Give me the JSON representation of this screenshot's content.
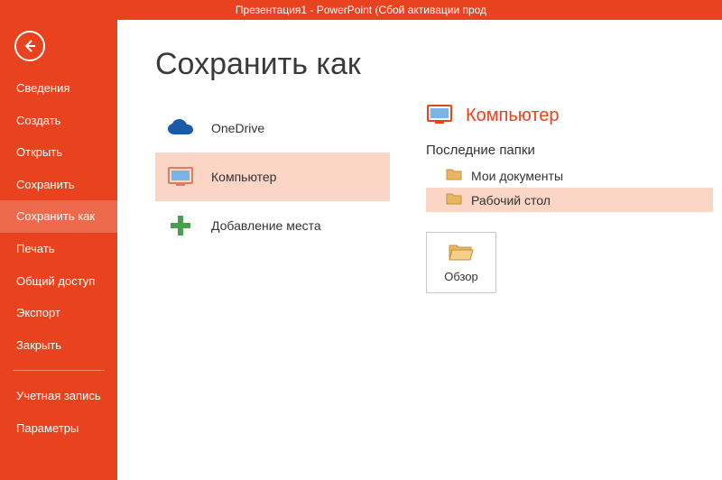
{
  "titlebar": "Презентация1 -  PowerPoint (Сбой активации прод",
  "sidebar": {
    "items": [
      "Сведения",
      "Создать",
      "Открыть",
      "Сохранить",
      "Сохранить как",
      "Печать",
      "Общий доступ",
      "Экспорт",
      "Закрыть"
    ],
    "bottom": [
      "Учетная запись",
      "Параметры"
    ],
    "selectedIndex": 4
  },
  "page": {
    "title": "Сохранить как",
    "locations": [
      {
        "icon": "cloud",
        "label": "OneDrive"
      },
      {
        "icon": "computer",
        "label": "Компьютер"
      },
      {
        "icon": "plus",
        "label": "Добавление места"
      }
    ],
    "selectedLocation": 1,
    "detail": {
      "title": "Компьютер",
      "recentLabel": "Последние папки",
      "recent": [
        "Мои документы",
        "Рабочий стол"
      ],
      "highlightedRecent": 1,
      "browse": "Обзор"
    }
  }
}
